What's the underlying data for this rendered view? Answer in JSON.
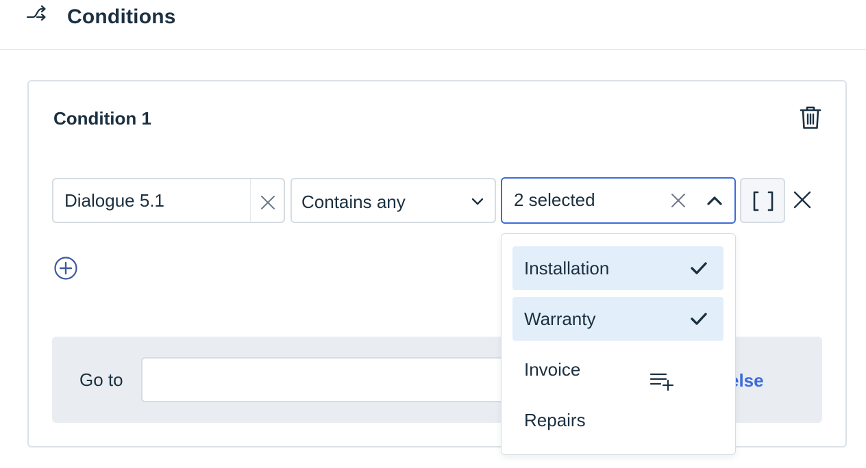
{
  "header": {
    "title": "Conditions",
    "icon": "branch-icon"
  },
  "condition": {
    "title": "Condition 1",
    "delete_icon": "trash-icon",
    "rule": {
      "variable": "Dialogue 5.1",
      "operator": "Contains any",
      "values_summary": "2 selected",
      "dropdown_open": true
    },
    "add_icon": "plus-circle-icon"
  },
  "dropdown": {
    "options": [
      {
        "label": "Installation",
        "selected": true
      },
      {
        "label": "Warranty",
        "selected": true
      },
      {
        "label": "Invoice",
        "selected": false
      },
      {
        "label": "Repairs",
        "selected": false
      }
    ]
  },
  "goto": {
    "label": "Go to",
    "value": "",
    "else_link": "else"
  },
  "colors": {
    "text": "#1b3040",
    "accent": "#3d6bd9",
    "selected_bg": "#e3eefb",
    "panel_bg": "#e9edf2",
    "border": "#d5dce3"
  }
}
